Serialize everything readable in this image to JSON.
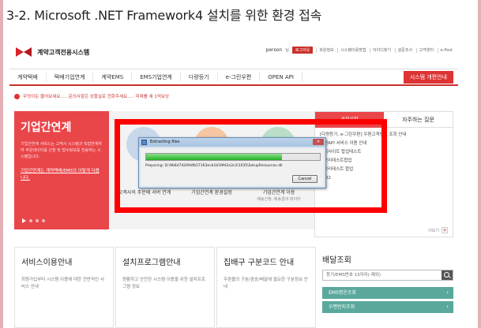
{
  "doc_title": "3-2. Microsoft .NET Framework4 설치를 위한 환경 접속",
  "header": {
    "logo_text": "계약고객전용시스템",
    "user_name": "person",
    "user_suffix": "님",
    "logout": "로그아웃",
    "links": [
      "회원정보",
      "시스템이용방법",
      "아이디찾기",
      "설문조사",
      "고객센터",
      "e-Post"
    ]
  },
  "gnb": {
    "items": [
      "계약택배",
      "택배기업연계",
      "계약EMS",
      "EMS기업연계",
      "다량등기",
      "e-그린우편",
      "OPEN API"
    ],
    "cta": "시스템 개편안내"
  },
  "notice": "무엇이든 물어보세요......문의사항은 상황실로 전화주세요..... 미래를 새 1억보상",
  "hero": {
    "title": "기업간연계",
    "desc": "기업간연계 서비스는 고객사 시스템과 직접연계하여 주문데이터를 신청 및 접수정보를 전송하는 시스템입니다.",
    "link": "기업간연계는 계약택배/EMS의 이렇게 다릅니다.",
    "features": [
      {
        "title": "고객사의 주문배 서버 연계",
        "sub": ""
      },
      {
        "title": "기업간연계 환경설정",
        "sub": ""
      },
      {
        "title": "기업간연계 이용",
        "sub": "배송신청, 배송결과 데이터"
      }
    ]
  },
  "side": {
    "tab_active": "공지사항",
    "tab_other": "자주하는 질문",
    "items": [
      "[다량등기, e-그린우편] 우편고객번호 조회 안내",
      "우편API 서비스 이용 안내",
      "공지사이트 합업테스트",
      "메모리테스트합업",
      "메모리테스트 합업",
      "0202"
    ],
    "more": "더보기"
  },
  "dialog": {
    "title": "Extracting files",
    "progress": 0.78,
    "text": "Preparing: D:\\9b6d74209dfb57163ecb1b59fd2a3c2\\1035\\SetupResources.dll",
    "cancel": "Cancel"
  },
  "cards": [
    {
      "title": "서비스이용안내",
      "desc": "회원가입부터 시스템 이용에 대한 전반적인 서비스 안내"
    },
    {
      "title": "설치프로그램안내",
      "desc": "원활하고 안전한 시스템 이용을 위한 설치프로그램 정보"
    },
    {
      "title": "집배구 구분코드 안내",
      "desc": "우편물의 구분/중송/배달에 필요한 구분정보 안내"
    }
  ],
  "lookup": {
    "title": "배달조회",
    "placeholder": "등기/EMS번호 13자리(-제외)",
    "rows": [
      "EMS명운조회",
      "우편번지조회"
    ]
  },
  "colors": {
    "brand_red": "#e9464a",
    "highlight_red": "#ff0000",
    "teal": "#5aa89c",
    "frame_pink": "#e3b0b6"
  }
}
